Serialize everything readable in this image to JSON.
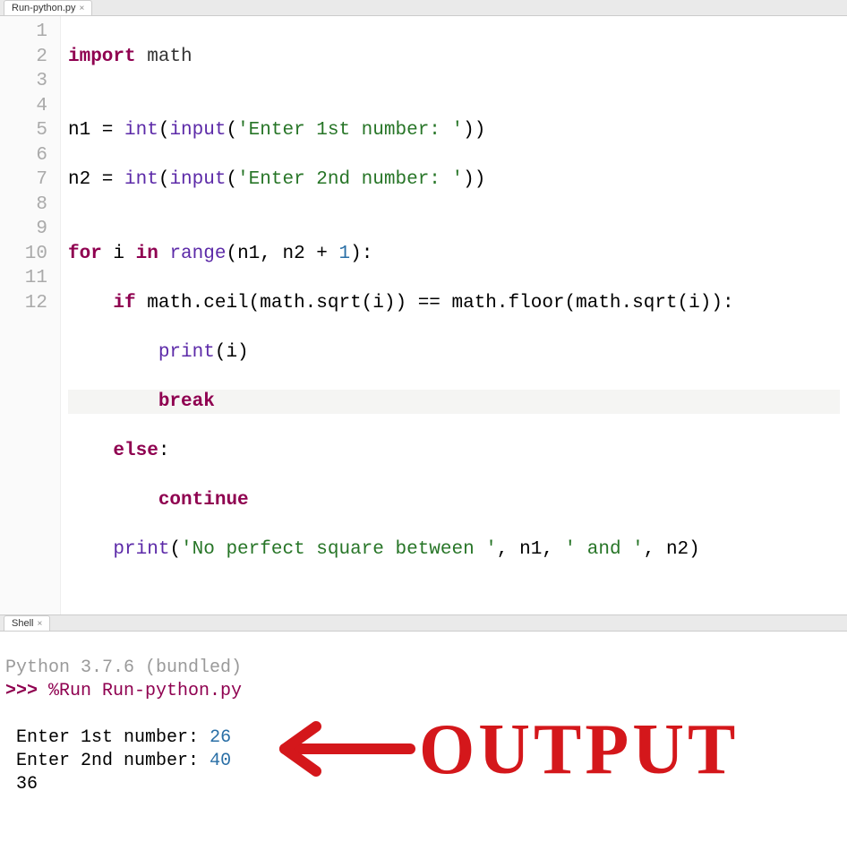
{
  "tabs": {
    "editor": "Run-python.py",
    "shell": "Shell"
  },
  "gutter": [
    "1",
    "2",
    "3",
    "4",
    "5",
    "6",
    "7",
    "8",
    "9",
    "10",
    "11",
    "12"
  ],
  "code": {
    "l1": {
      "kw": "import",
      "sp": " ",
      "mod": "math"
    },
    "l2": "",
    "l3": {
      "lhs": "n1 = ",
      "fn1": "int",
      "p1": "(",
      "fn2": "input",
      "p2": "(",
      "str": "'Enter 1st number: '",
      "p3": "))"
    },
    "l4": {
      "lhs": "n2 = ",
      "fn1": "int",
      "p1": "(",
      "fn2": "input",
      "p2": "(",
      "str": "'Enter 2nd number: '",
      "p3": "))"
    },
    "l5": "",
    "l6": {
      "kw1": "for",
      "mid": " i ",
      "kw2": "in",
      "sp": " ",
      "fn": "range",
      "args1": "(n1, n2 + ",
      "num": "1",
      "args2": "):"
    },
    "l7": {
      "indent": "    ",
      "kw": "if",
      "cond1": " math.ceil(math.sqrt(i)) == math.floor(math.sqrt(i)):"
    },
    "l8": {
      "indent": "        ",
      "fn": "print",
      "args": "(i)"
    },
    "l9": {
      "indent": "        ",
      "kw": "break"
    },
    "l10": {
      "indent": "    ",
      "kw": "else",
      "colon": ":"
    },
    "l11": {
      "indent": "        ",
      "kw": "continue"
    },
    "l12": {
      "indent": "    ",
      "fn": "print",
      "p1": "(",
      "str1": "'No perfect square between '",
      "c1": ", n1, ",
      "str2": "' and '",
      "c2": ", n2)"
    }
  },
  "shell": {
    "version": "Python 3.7.6 (bundled)",
    "prompt": ">>> ",
    "run_cmd": "%Run Run-python.py",
    "io": [
      {
        "prompt_text": "Enter 1st number: ",
        "value": "26"
      },
      {
        "prompt_text": "Enter 2nd number: ",
        "value": "40"
      }
    ],
    "result": "36"
  },
  "annotation": "OUTPUT"
}
